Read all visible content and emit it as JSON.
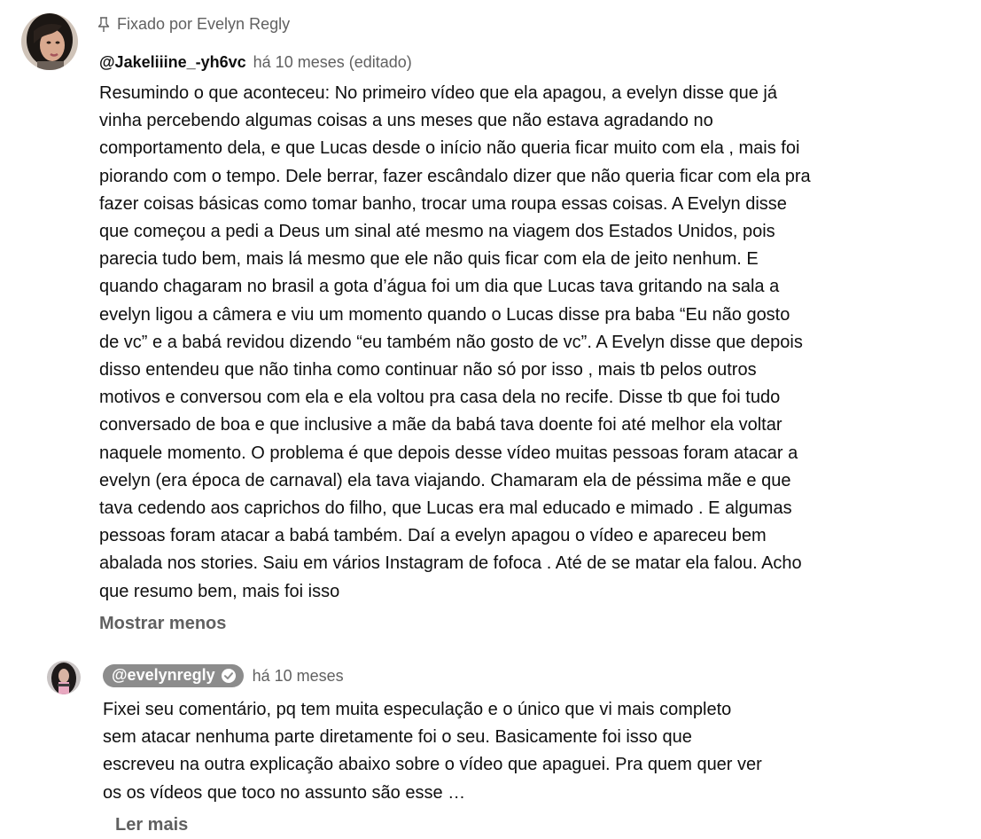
{
  "pinned_comment": {
    "pinned_label": "Fixado por Evelyn Regly",
    "author": "@Jakeliiine_-yh6vc",
    "time": "há 10 meses (editado)",
    "lines": [
      "Resumindo o que aconteceu: No primeiro vídeo que ela apagou, a evelyn disse que já",
      "vinha percebendo algumas coisas a uns meses que não estava agradando no",
      "comportamento dela, e que Lucas desde o início não queria ficar muito com ela , mais foi",
      "piorando com o tempo. Dele berrar, fazer escândalo dizer que não queria ficar com ela pra",
      "fazer coisas básicas como tomar banho, trocar uma roupa essas coisas. A Evelyn disse",
      "que começou a pedi a Deus um sinal até mesmo na viagem dos Estados Unidos, pois",
      "parecia tudo bem, mais lá mesmo que ele não quis ficar com ela de jeito nenhum. E",
      "quando chagaram no brasil a gota d’água foi um dia que Lucas tava gritando na sala a",
      "evelyn ligou a câmera e viu um momento quando o Lucas disse pra baba “Eu não gosto",
      "de vc” e a babá revidou dizendo “eu também não gosto de vc”. A Evelyn disse que depois",
      "disso entendeu que não tinha como continuar não só por isso , mais tb pelos outros",
      "motivos e conversou com ela e ela voltou pra casa dela no recife. Disse tb que foi tudo",
      "conversado de boa e que inclusive a mãe da babá tava doente foi até melhor ela voltar",
      "naquele momento. O problema é que depois desse vídeo muitas pessoas foram atacar a",
      "evelyn (era época de carnaval) ela tava viajando. Chamaram ela de péssima mãe e que",
      "tava cedendo aos caprichos do filho, que Lucas era mal educado e mimado . E algumas",
      "pessoas foram atacar a babá também. Daí a evelyn apagou o vídeo e apareceu bem",
      "abalada nos stories. Saiu em vários Instagram de fofoca . Até de se matar ela falou. Acho",
      "que resumo bem, mais foi isso"
    ],
    "toggle_label": "Mostrar menos"
  },
  "reply": {
    "author": "@evelynregly",
    "time": "há 10 meses",
    "lines": [
      "Fixei seu comentário, pq tem muita especulação e o único que vi mais completo",
      "sem atacar nenhuma parte diretamente foi o seu. Basicamente foi isso que",
      "escreveu na outra explicação abaixo sobre o vídeo que apaguei. Pra quem quer ver",
      "os os vídeos que toco no assunto são esse …"
    ],
    "toggle_label": "Ler mais"
  },
  "icons": {
    "pin": "pin-icon",
    "verified": "verified-check-icon"
  },
  "colors": {
    "text": "#0f0f0f",
    "secondary_text": "#606060",
    "creator_chip_bg": "#8c8c8c"
  }
}
